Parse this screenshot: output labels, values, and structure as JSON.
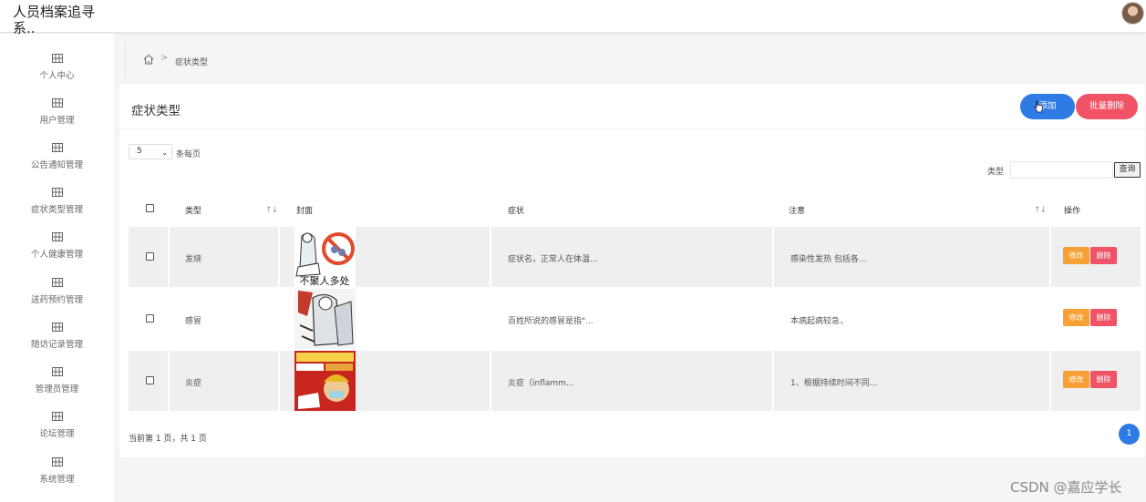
{
  "header": {
    "app_title": "人员档案追寻系..",
    "avatar": "user-avatar"
  },
  "sidebar": {
    "items": [
      {
        "label": "个人中心",
        "icon": "grid-icon"
      },
      {
        "label": "用户管理",
        "icon": "grid-icon"
      },
      {
        "label": "公告通知管理",
        "icon": "grid-icon"
      },
      {
        "label": "症状类型管理",
        "icon": "grid-icon"
      },
      {
        "label": "个人健康管理",
        "icon": "grid-icon"
      },
      {
        "label": "送药预约管理",
        "icon": "grid-icon"
      },
      {
        "label": "随访记录管理",
        "icon": "grid-icon"
      },
      {
        "label": "管理员管理",
        "icon": "grid-icon"
      },
      {
        "label": "论坛管理",
        "icon": "grid-icon"
      },
      {
        "label": "系统管理",
        "icon": "grid-icon"
      }
    ]
  },
  "breadcrumb": {
    "home_icon": "home-icon",
    "separator": ">",
    "current": "症状类型"
  },
  "main": {
    "title": "症状类型",
    "add_button": "添加",
    "batch_delete_button": "批量删除",
    "page_size": "5",
    "per_page_label": "条每页",
    "search": {
      "label": "类型",
      "value": "",
      "button": "查询"
    },
    "columns": [
      "类型",
      "封面",
      "症状",
      "注意",
      "操作"
    ],
    "sort_glyph": "↑↓",
    "rows": [
      {
        "type": "发烧",
        "cover_caption": "不聚人多处",
        "symptom": "症状名，正常人在体温...",
        "note": "感染性发热 包括各...",
        "edit": "修改",
        "delete": "删除"
      },
      {
        "type": "感冒",
        "cover_caption": "",
        "symptom": "百姓所说的感冒是指\"...",
        "note": "本病起病较急，",
        "edit": "修改",
        "delete": "删除"
      },
      {
        "type": "炎症",
        "cover_caption": "",
        "symptom": "炎症（inflamm...",
        "note": "1、根据持续时间不同...",
        "edit": "修改",
        "delete": "删除"
      }
    ],
    "page_info": "当前第 1 页，共 1 页",
    "current_page": "1"
  },
  "watermark": "CSDN @嘉应学长",
  "colors": {
    "primary": "#2e7be6",
    "danger": "#ef5365",
    "warning": "#f6a035"
  }
}
